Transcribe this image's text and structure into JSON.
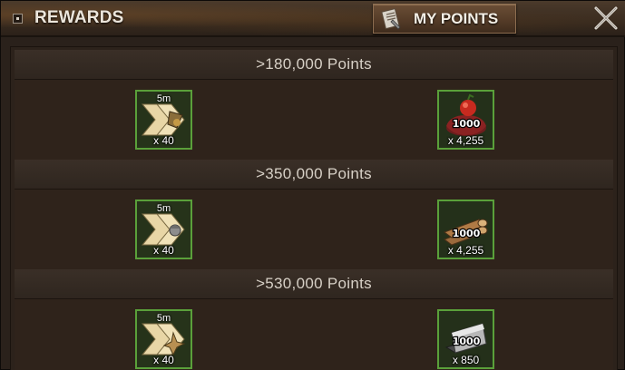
{
  "header": {
    "title": "REWARDS",
    "my_points_label": "MY POINTS"
  },
  "tiers": [
    {
      "label": ">180,000 Points",
      "rewards": [
        {
          "icon": "speedup-chevron-icon",
          "duration": "5m",
          "quantity": "x 40"
        },
        {
          "icon": "food-apple-icon",
          "amount": "1000",
          "quantity": "x 4,255"
        }
      ]
    },
    {
      "label": ">350,000 Points",
      "rewards": [
        {
          "icon": "speedup-chevron-icon",
          "duration": "5m",
          "quantity": "x 40"
        },
        {
          "icon": "wood-logs-icon",
          "amount": "1000",
          "quantity": "x 4,255"
        }
      ]
    },
    {
      "label": ">530,000 Points",
      "rewards": [
        {
          "icon": "speedup-chevron-icon",
          "duration": "5m",
          "quantity": "x 40"
        },
        {
          "icon": "iron-ingot-icon",
          "amount": "1000",
          "quantity": "x 850"
        }
      ]
    }
  ]
}
